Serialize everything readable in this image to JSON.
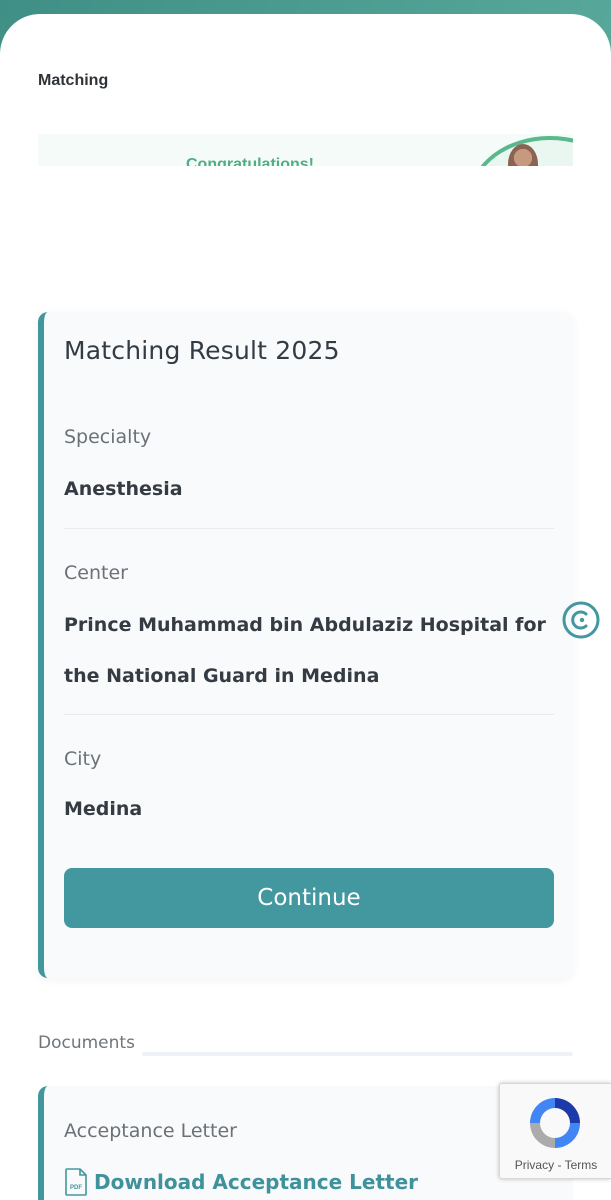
{
  "header": {
    "title": "Matching"
  },
  "banner": {
    "text": "Congratulations!"
  },
  "result_card": {
    "title": "Matching Result 2025",
    "fields": [
      {
        "label": "Specialty",
        "value": "Anesthesia"
      },
      {
        "label": "Center",
        "value": "Prince Muhammad bin Abdulaziz Hospital for the National Guard in Medina"
      },
      {
        "label": "City",
        "value": "Medina"
      }
    ],
    "continue_label": "Continue"
  },
  "documents": {
    "section_label": "Documents",
    "items": [
      {
        "title": "Acceptance Letter",
        "link_label": "Download Acceptance Letter",
        "icon": "pdf-file-icon"
      }
    ]
  },
  "recaptcha": {
    "privacy_label": "Privacy",
    "separator": "-",
    "terms_label": "Terms"
  },
  "colors": {
    "accent": "#43979f",
    "banner_green": "#4fae84",
    "text_dark": "#333b44",
    "text_muted": "#6b7177"
  }
}
